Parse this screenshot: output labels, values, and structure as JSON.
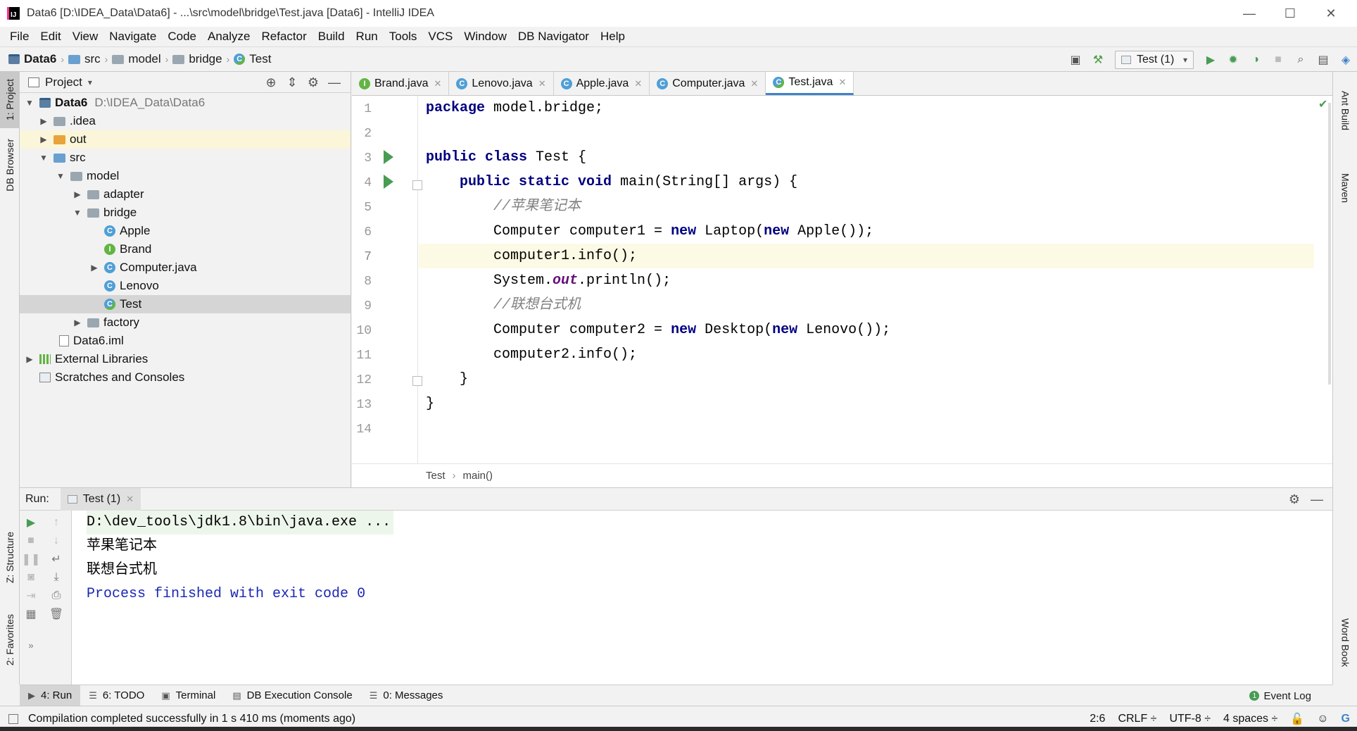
{
  "window": {
    "title": "Data6 [D:\\IDEA_Data\\Data6] - ...\\src\\model\\bridge\\Test.java [Data6] - IntelliJ IDEA",
    "app_icon": "IJ",
    "minimize": "—",
    "maximize": "☐",
    "close": "✕"
  },
  "menu": [
    {
      "label": "File"
    },
    {
      "label": "Edit"
    },
    {
      "label": "View"
    },
    {
      "label": "Navigate"
    },
    {
      "label": "Code"
    },
    {
      "label": "Analyze"
    },
    {
      "label": "Refactor"
    },
    {
      "label": "Build"
    },
    {
      "label": "Run"
    },
    {
      "label": "Tools"
    },
    {
      "label": "VCS"
    },
    {
      "label": "Window"
    },
    {
      "label": "DB Navigator"
    },
    {
      "label": "Help"
    }
  ],
  "breadcrumb": [
    "Data6",
    "src",
    "model",
    "bridge",
    "Test"
  ],
  "toolbar": {
    "run_config": "Test (1)"
  },
  "left_strip": {
    "project": "1: Project",
    "db_browser": "DB Browser",
    "structure": "Z: Structure",
    "favorites": "2: Favorites"
  },
  "right_strip": {
    "ant": "Ant Build",
    "maven": "Maven",
    "word_book": "Word Book"
  },
  "project": {
    "header": "Project",
    "tree": [
      {
        "label": "Data6",
        "extra": "D:\\IDEA_Data\\Data6"
      },
      {
        "label": ".idea"
      },
      {
        "label": "out"
      },
      {
        "label": "src"
      },
      {
        "label": "model"
      },
      {
        "label": "adapter"
      },
      {
        "label": "bridge"
      },
      {
        "label": "Apple"
      },
      {
        "label": "Brand"
      },
      {
        "label": "Computer.java"
      },
      {
        "label": "Lenovo"
      },
      {
        "label": "Test"
      },
      {
        "label": "factory"
      },
      {
        "label": "Data6.iml"
      },
      {
        "label": "External Libraries"
      },
      {
        "label": "Scratches and Consoles"
      }
    ]
  },
  "tabs": [
    {
      "label": "Brand.java",
      "icon": "I"
    },
    {
      "label": "Lenovo.java",
      "icon": "C"
    },
    {
      "label": "Apple.java",
      "icon": "C"
    },
    {
      "label": "Computer.java",
      "icon": "C"
    },
    {
      "label": "Test.java",
      "icon": "C"
    }
  ],
  "editor": {
    "line_numbers": [
      "1",
      "2",
      "3",
      "4",
      "5",
      "6",
      "7",
      "8",
      "9",
      "10",
      "11",
      "12",
      "13",
      "14"
    ],
    "code": {
      "l1_kw": "package",
      "l1_rest": " model.bridge;",
      "l3_kw": "public class",
      "l3_rest": " Test {",
      "l4_indent": "    ",
      "l4_kw": "public static void",
      "l4_rest": " main(String[] args) {",
      "l5_indent": "        ",
      "l5_comment": "//苹果笔记本",
      "l6_a": "        Computer computer1 = ",
      "l6_kw1": "new",
      "l6_b": " Laptop(",
      "l6_kw2": "new",
      "l6_c": " Apple());",
      "l7": "        computer1.info();",
      "l8_a": "        System.",
      "l8_field": "out",
      "l8_b": ".println();",
      "l9_indent": "        ",
      "l9_comment": "//联想台式机",
      "l10_a": "        Computer computer2 = ",
      "l10_kw1": "new",
      "l10_b": " Desktop(",
      "l10_kw2": "new",
      "l10_c": " Lenovo());",
      "l11": "        computer2.info();",
      "l12": "    }",
      "l13": "}"
    },
    "crumbs": [
      "Test",
      "main()"
    ]
  },
  "run": {
    "label": "Run:",
    "tab": "Test (1)",
    "console": {
      "cmd": "D:\\dev_tools\\jdk1.8\\bin\\java.exe ...",
      "out1": "苹果笔记本",
      "out2": "联想台式机",
      "finished": "Process finished with exit code 0"
    }
  },
  "bottom_tabs": [
    {
      "label": "4: Run"
    },
    {
      "label": "6: TODO"
    },
    {
      "label": "Terminal"
    },
    {
      "label": "DB Execution Console"
    },
    {
      "label": "0: Messages"
    }
  ],
  "event_log": "Event Log",
  "status": {
    "message": "Compilation completed successfully in 1 s 410 ms (moments ago)",
    "position": "2:6",
    "line_sep": "CRLF ÷",
    "encoding": "UTF-8 ÷",
    "indent": "4 spaces ÷"
  }
}
